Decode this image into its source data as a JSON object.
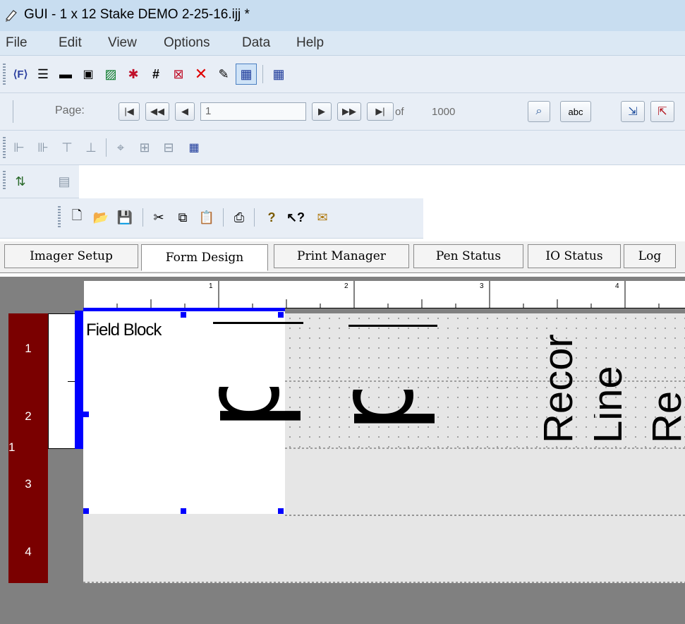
{
  "window": {
    "title": "GUI - 1 x 12 Stake DEMO 2-25-16.ijj *"
  },
  "menu": [
    "File",
    "Edit",
    "View",
    "Options",
    "Data",
    "Help"
  ],
  "navigation": {
    "page_label": "Page:",
    "page_value": "1",
    "of_label": "of",
    "total_pages": "1000",
    "abc_label": "abc"
  },
  "tabs": [
    "Imager Setup",
    "Form Design",
    "Print Manager",
    "Pen Status",
    "IO Status",
    "Log"
  ],
  "active_tab": "Form Design",
  "design": {
    "ruler_ticks": [
      "1",
      "2",
      "3",
      "4"
    ],
    "row_numbers": [
      "1",
      "2",
      "3",
      "4"
    ],
    "left_marker": "1",
    "field_block_label": "Field Block",
    "glyph_1": "d",
    "glyph_2": "d",
    "rotated_1": "Recor",
    "rotated_2": "Line",
    "rotated_3": "Re"
  },
  "colors": {
    "selection": "#0000ff",
    "row_sidebar": "#7a0000",
    "title_bar": "#c8ddf0"
  }
}
